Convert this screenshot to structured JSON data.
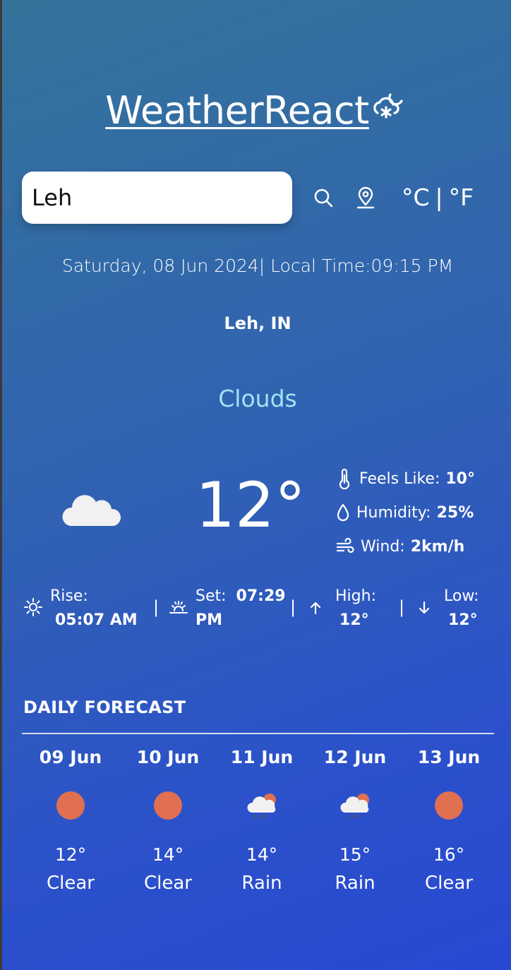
{
  "header": {
    "title": "WeatherReact",
    "logo_icon": "cloud-sun-icon"
  },
  "search": {
    "value": "Leh",
    "search_icon": "search-icon",
    "location_icon": "location-pin-icon"
  },
  "units": {
    "celsius": "°C",
    "separator": "|",
    "fahrenheit": "°F"
  },
  "datetime": "Saturday, 08 Jun 2024| Local Time:09:15 PM",
  "location": "Leh, IN",
  "current": {
    "condition": "Clouds",
    "temperature": "12°",
    "icon": "cloud-icon",
    "feels_like": {
      "label": "Feels Like:",
      "value": "10°",
      "icon": "thermometer-icon"
    },
    "humidity": {
      "label": "Humidity:",
      "value": "25%",
      "icon": "droplet-icon"
    },
    "wind": {
      "label": "Wind:",
      "value": "2km/h",
      "icon": "wind-icon"
    }
  },
  "sun": {
    "rise_label": "Rise:",
    "rise_value": "05:07 AM",
    "set_label": "Set:",
    "set_value_1": "07:29",
    "set_value_2": "PM",
    "high_label": "High:",
    "high_value": "12°",
    "low_label": "Low:",
    "low_value": "12°",
    "separator": "|"
  },
  "forecast": {
    "title": "DAILY FORECAST",
    "days": [
      {
        "date": "09 Jun",
        "temp": "12°",
        "desc": "Clear",
        "icon": "sun-icon"
      },
      {
        "date": "10 Jun",
        "temp": "14°",
        "desc": "Clear",
        "icon": "sun-icon"
      },
      {
        "date": "11 Jun",
        "temp": "14°",
        "desc": "Rain",
        "icon": "rain-cloud-sun-icon"
      },
      {
        "date": "12 Jun",
        "temp": "15°",
        "desc": "Rain",
        "icon": "rain-cloud-sun-icon"
      },
      {
        "date": "13 Jun",
        "temp": "16°",
        "desc": "Clear",
        "icon": "sun-icon"
      }
    ]
  },
  "colors": {
    "condition": "#9fe6f3",
    "sun": "#e07050",
    "background_start": "#34749a",
    "background_end": "#2848d2"
  }
}
